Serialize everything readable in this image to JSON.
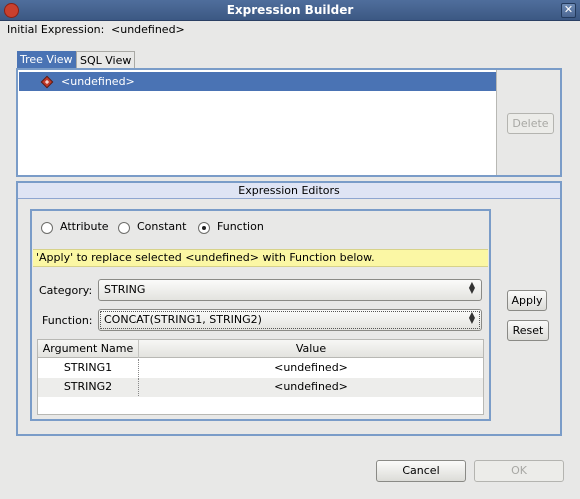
{
  "window": {
    "title": "Expression Builder",
    "close_glyph": "✕"
  },
  "initial_expression": {
    "label": "Initial Expression:",
    "value": "<undefined>"
  },
  "tabs": [
    {
      "label": "Tree View",
      "active": true
    },
    {
      "label": "SQL View",
      "active": false
    }
  ],
  "tree": {
    "selected_node": "<undefined>",
    "node_icon": "diamond-icon"
  },
  "delete_button": "Delete",
  "editors": {
    "header": "Expression Editors",
    "radios": [
      {
        "label": "Attribute",
        "checked": false
      },
      {
        "label": "Constant",
        "checked": false
      },
      {
        "label": "Function",
        "checked": true
      }
    ],
    "hint": "'Apply' to replace selected <undefined> with Function below.",
    "category_label": "Category:",
    "category_value": "STRING",
    "function_label": "Function:",
    "function_value": "CONCAT(STRING1, STRING2)",
    "table": {
      "columns": [
        "Argument Name",
        "Value"
      ],
      "rows": [
        {
          "name": "STRING1",
          "value": "<undefined>"
        },
        {
          "name": "STRING2",
          "value": "<undefined>"
        }
      ]
    }
  },
  "apply_button": "Apply",
  "reset_button": "Reset",
  "cancel_button": "Cancel",
  "ok_button": "OK",
  "colors": {
    "selection": "#4a73b4",
    "hint_bg": "#fbf7a4",
    "border": "#7a9cc8"
  }
}
